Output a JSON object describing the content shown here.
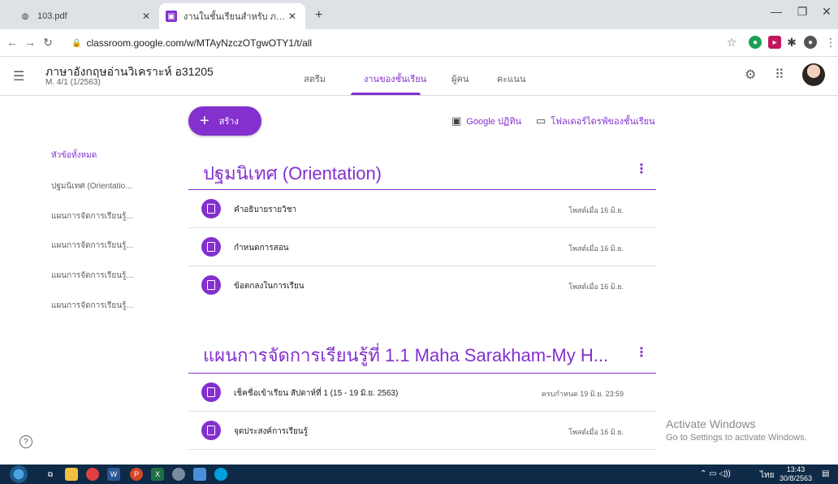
{
  "browser": {
    "tabs": [
      {
        "title": "103.pdf"
      },
      {
        "title": "งานในชั้นเรียนสำหรับ ภาษาอังกฤษอ่าน"
      }
    ],
    "url": "classroom.google.com/w/MTAyNzczOTgwOTY1/t/all"
  },
  "classroom": {
    "title": "ภาษาอังกฤษอ่านวิเคราะห์ อ31205",
    "subtitle": "M. 4/1 (1/2563)",
    "nav_tabs": [
      "สตรีม",
      "งานของชั้นเรียน",
      "ผู้คน",
      "คะแนน"
    ],
    "create_label": "สร้าง",
    "calendar_link": "Google ปฏิทิน",
    "drive_link": "โฟลเดอร์ไดรฟ์ของชั้นเรียน"
  },
  "sidebar": {
    "items": [
      "หัวข้อทั้งหมด",
      "ปฐมนิเทศ (Orientatio...",
      "แผนการจัดการเรียนรู้...",
      "แผนการจัดการเรียนรู้...",
      "แผนการจัดการเรียนรู้...",
      "แผนการจัดการเรียนรู้..."
    ]
  },
  "topics": [
    {
      "title": "ปฐมนิเทศ (Orientation)",
      "items": [
        {
          "title": "คำอธิบายรายวิชา",
          "date": "โพสต์เมื่อ 16 มิ.ย."
        },
        {
          "title": "กำหนดการสอน",
          "date": "โพสต์เมื่อ 16 มิ.ย."
        },
        {
          "title": "ข้อตกลงในการเรียน",
          "date": "โพสต์เมื่อ 16 มิ.ย."
        }
      ]
    },
    {
      "title": "แผนการจัดการเรียนรู้ที่ 1.1 Maha Sarakham-My H...",
      "items": [
        {
          "title": "เช็คชื่อเข้าเรียน สัปดาห์ที่ 1 (15 - 19 มิ.ย. 2563)",
          "date": "ครบกำหนด 19 มิ.ย. 23:59"
        },
        {
          "title": "จุดประสงค์การเรียนรู้",
          "date": "โพสต์เมื่อ 16 มิ.ย."
        }
      ]
    }
  ],
  "watermark": {
    "line1": "Activate Windows",
    "line2": "Go to Settings to activate Windows."
  },
  "taskbar": {
    "lang": "ไทย",
    "time": "13:43",
    "date": "30/8/2563"
  },
  "colors": {
    "accent": "#8430ce"
  }
}
